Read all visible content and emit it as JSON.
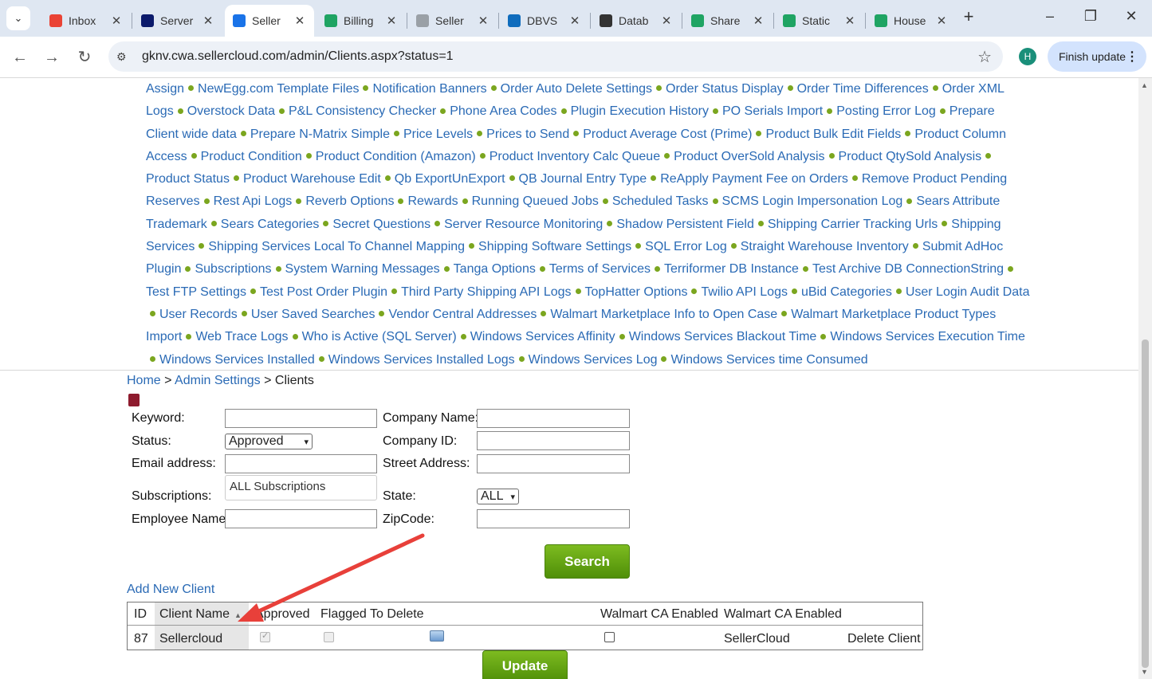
{
  "browser": {
    "tabs": [
      {
        "title": "Inbox",
        "icon": "gmail-icon",
        "color": "#ea4335"
      },
      {
        "title": "Server",
        "icon": "server-icon",
        "color": "#0b1a6b"
      },
      {
        "title": "Seller",
        "icon": "cloud-icon",
        "color": "#1a73e8",
        "active": true
      },
      {
        "title": "Billing",
        "icon": "sheets-icon",
        "color": "#1fa463"
      },
      {
        "title": "Seller",
        "icon": "doc-icon",
        "color": "#9aa0a6"
      },
      {
        "title": "DBVS",
        "icon": "onedrive-icon",
        "color": "#0f6cbd"
      },
      {
        "title": "Datab",
        "icon": "openai-icon",
        "color": "#333333"
      },
      {
        "title": "Share",
        "icon": "sheets-icon",
        "color": "#1fa463"
      },
      {
        "title": "Static",
        "icon": "sheets-icon",
        "color": "#1fa463"
      },
      {
        "title": "House",
        "icon": "sheets-icon",
        "color": "#1fa463"
      }
    ],
    "url": "gknv.cwa.sellercloud.com/admin/Clients.aspx?status=1",
    "profile_initial": "H",
    "finish_update": "Finish update"
  },
  "links": [
    "Assign",
    "NewEgg.com Template Files",
    "Notification Banners",
    "Order Auto Delete Settings",
    "Order Status Display",
    "Order Time Differences",
    "Order XML Logs",
    "Overstock Data",
    "P&L Consistency Checker",
    "Phone Area Codes",
    "Plugin Execution History",
    "PO Serials Import",
    "Posting Error Log",
    "Prepare Client wide data",
    "Prepare N-Matrix Simple",
    "Price Levels",
    "Prices to Send",
    "Product Average Cost (Prime)",
    "Product Bulk Edit Fields",
    "Product Column Access",
    "Product Condition",
    "Product Condition (Amazon)",
    "Product Inventory Calc Queue",
    "Product OverSold Analysis",
    "Product QtySold Analysis",
    "Product Status",
    "Product Warehouse Edit",
    "Qb ExportUnExport",
    "QB Journal Entry Type",
    "ReApply Payment Fee on Orders",
    "Remove Product Pending Reserves",
    "Rest Api Logs",
    "Reverb Options",
    "Rewards",
    "Running Queued Jobs",
    "Scheduled Tasks",
    "SCMS Login Impersonation Log",
    "Sears Attribute Trademark",
    "Sears Categories",
    "Secret Questions",
    "Server Resource Monitoring",
    "Shadow Persistent Field",
    "Shipping Carrier Tracking Urls",
    "Shipping Services",
    "Shipping Services Local To Channel Mapping",
    "Shipping Software Settings",
    "SQL Error Log",
    "Straight Warehouse Inventory",
    "Submit AdHoc Plugin",
    "Subscriptions",
    "System Warning Messages",
    "Tanga Options",
    "Terms of Services",
    "Terriformer DB Instance",
    "Test Archive DB ConnectionString",
    "Test FTP Settings",
    "Test Post Order Plugin",
    "Third Party Shipping API Logs",
    "TopHatter Options",
    "Twilio API Logs",
    "uBid Categories",
    "User Login Audit Data",
    "User Records",
    "User Saved Searches",
    "Vendor Central Addresses",
    "Walmart Marketplace Info to Open Case",
    "Walmart Marketplace Product Types Import",
    "Web Trace Logs",
    "Who is Active (SQL Server)",
    "Windows Services Affinity",
    "Windows Services Blackout Time",
    "Windows Services Execution Time",
    "Windows Services Installed",
    "Windows Services Installed Logs",
    "Windows Services Log",
    "Windows Services time Consumed"
  ],
  "breadcrumb": {
    "home": "Home",
    "sep": ">",
    "admin": "Admin Settings",
    "current": "Clients"
  },
  "form": {
    "keyword_label": "Keyword:",
    "company_name_label": "Company Name:",
    "status_label": "Status:",
    "status_value": "Approved",
    "company_id_label": "Company ID:",
    "email_label": "Email address:",
    "street_label": "Street Address:",
    "subscriptions_label": "Subscriptions:",
    "subscriptions_value": "ALL Subscriptions",
    "state_label": "State:",
    "state_value": "ALL",
    "employee_label": "Employee Name",
    "zip_label": "ZipCode:",
    "search_button": "Search"
  },
  "add_new_client": "Add New Client",
  "table": {
    "headers": [
      "ID",
      "Client Name",
      "Approved",
      "Flagged To Delete",
      "Walmart CA Enabled",
      "Walmart CA Enabled"
    ],
    "rows": [
      {
        "id": "87",
        "client_name": "Sellercloud",
        "approved": true,
        "flagged": false,
        "walmart_enabled": false,
        "walmart_name": "SellerCloud",
        "delete": "Delete Client"
      }
    ]
  },
  "update_button": "Update"
}
